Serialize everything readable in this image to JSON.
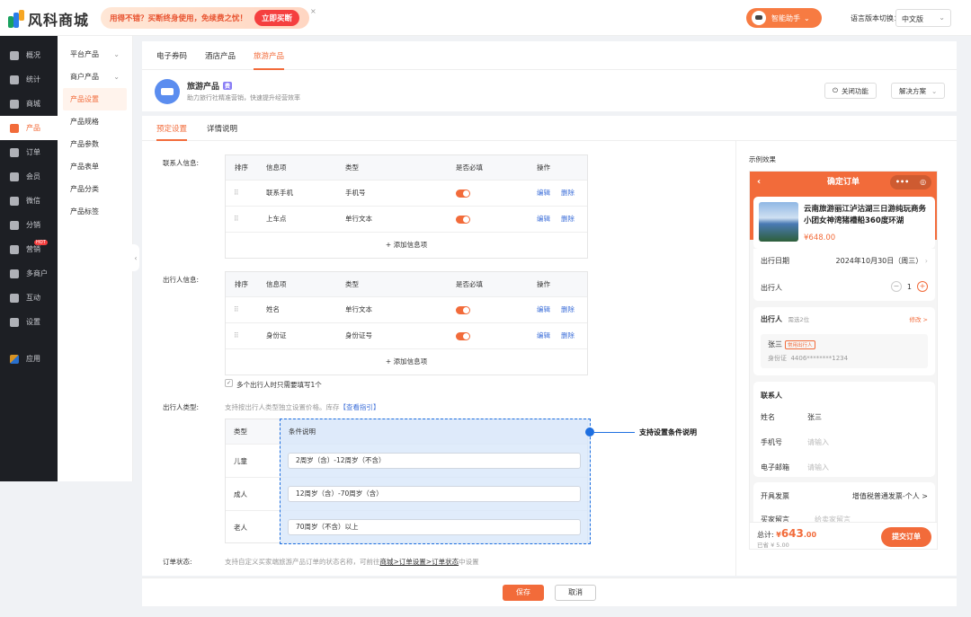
{
  "app": {
    "logo_text": "风科商城"
  },
  "promo": {
    "text": "用得不错？买断终身使用，免续费之忧！",
    "button": "立即买断",
    "close": "×"
  },
  "assistant": {
    "label": "智能助手",
    "chevron": "⌄"
  },
  "language": {
    "label": "语言版本切换：",
    "value": "中文版"
  },
  "sidebar": {
    "items": [
      {
        "label": "概况",
        "icon": "layers-icon"
      },
      {
        "label": "统计",
        "icon": "chart-icon"
      },
      {
        "label": "商城",
        "icon": "store-icon"
      },
      {
        "label": "产品",
        "icon": "grid-icon"
      },
      {
        "label": "订单",
        "icon": "order-icon"
      },
      {
        "label": "会员",
        "icon": "crown-icon"
      },
      {
        "label": "微信",
        "icon": "wechat-icon"
      },
      {
        "label": "分销",
        "icon": "distribution-icon"
      },
      {
        "label": "营销",
        "icon": "flag-icon",
        "badge": "HOT"
      },
      {
        "label": "多商户",
        "icon": "merchant-icon"
      },
      {
        "label": "互动",
        "icon": "interact-icon"
      },
      {
        "label": "设置",
        "icon": "settings-icon"
      },
      {
        "label": "应用",
        "icon": "apps-icon"
      }
    ]
  },
  "subnav": {
    "items": [
      {
        "label": "平台产品",
        "has_chevron": true
      },
      {
        "label": "商户产品",
        "has_chevron": true
      },
      {
        "label": "产品设置",
        "active": true
      },
      {
        "label": "产品规格"
      },
      {
        "label": "产品参数"
      },
      {
        "label": "产品表单"
      },
      {
        "label": "产品分类"
      },
      {
        "label": "产品标签"
      }
    ]
  },
  "top_tabs": [
    "电子券码",
    "酒店产品",
    "旅游产品"
  ],
  "product": {
    "title": "旅游产品",
    "tag": "费",
    "desc": "助力旅行社精准营销，快速提升经营效率",
    "close_btn": "关闭功能",
    "solution_btn": "解决方案"
  },
  "sub_tabs": [
    "预定设置",
    "详情说明"
  ],
  "contact": {
    "label": "联系人信息:",
    "headers": [
      "排序",
      "信息项",
      "类型",
      "是否必填",
      "操作"
    ],
    "rows": [
      {
        "drag": "⠿",
        "name": "联系手机",
        "type": "手机号",
        "edit": "编辑",
        "del": "删除"
      },
      {
        "drag": "⠿",
        "name": "上车点",
        "type": "单行文本",
        "edit": "编辑",
        "del": "删除"
      }
    ],
    "add": "+ 添加信息项"
  },
  "traveler": {
    "label": "出行人信息:",
    "headers": [
      "排序",
      "信息项",
      "类型",
      "是否必填",
      "操作"
    ],
    "rows": [
      {
        "drag": "⠿",
        "name": "姓名",
        "type": "单行文本",
        "edit": "编辑",
        "del": "删除"
      },
      {
        "drag": "⠿",
        "name": "身份证",
        "type": "身份证号",
        "edit": "编辑",
        "del": "删除"
      }
    ],
    "add": "+ 添加信息项",
    "checkbox": "多个出行人时只需要填写1个"
  },
  "traveler_type": {
    "label": "出行人类型:",
    "hint": "支持按出行人类型独立设置价格。库存",
    "hint_link": "【查看指引】",
    "headers": [
      "类型",
      "条件说明"
    ],
    "rows": [
      {
        "type": "儿童",
        "cond": "2周岁（含）-12周岁（不含）"
      },
      {
        "type": "成人",
        "cond": "12周岁（含）-70周岁（含）"
      },
      {
        "type": "老人",
        "cond": "70周岁（不含）以上"
      }
    ],
    "callout": "支持设置条件说明"
  },
  "order_status": {
    "label": "订单状态:",
    "hint": "支持自定义买家端旅游产品订单的状态名称，可前往",
    "hint_link": "商城>订单设置>订单状态",
    "hint_tail": "中设置"
  },
  "actions": {
    "save": "保存",
    "cancel": "取消"
  },
  "preview": {
    "label": "示例效果",
    "header": "确定订单",
    "product_title": "云南旅游丽江泸沽湖三日游纯玩商务小团女神湾猪槽船360度环湖",
    "price": "¥648.00",
    "date_label": "出行日期",
    "date_value": "2024年10月30日（周三）",
    "traveler_label": "出行人",
    "qty": "1",
    "trav_section": "出行人",
    "trav_need": "需选2位",
    "trav_modify": "修改 >",
    "trav_name": "张三",
    "trav_badge": "常用出行人",
    "trav_id_label": "身份证",
    "trav_id": "4406********1234",
    "contact_section": "联系人",
    "name_label": "姓名",
    "name_value": "张三",
    "phone_label": "手机号",
    "phone_ph": "请输入",
    "email_label": "电子邮箱",
    "email_ph": "请输入",
    "invoice_label": "开具发票",
    "invoice_value": "增值税普通发票-个人 >",
    "note_label": "买家留言",
    "note_ph": "给卖家留言",
    "total_label": "总计:",
    "total_cur": "¥",
    "total_int": "643",
    "total_dec": ".00",
    "saved": "已省 ¥ 5.00",
    "submit": "提交订单"
  },
  "colors": {
    "accent": "#f26b3a",
    "link": "#3d6fd9",
    "selection": "#1e6fe0"
  }
}
